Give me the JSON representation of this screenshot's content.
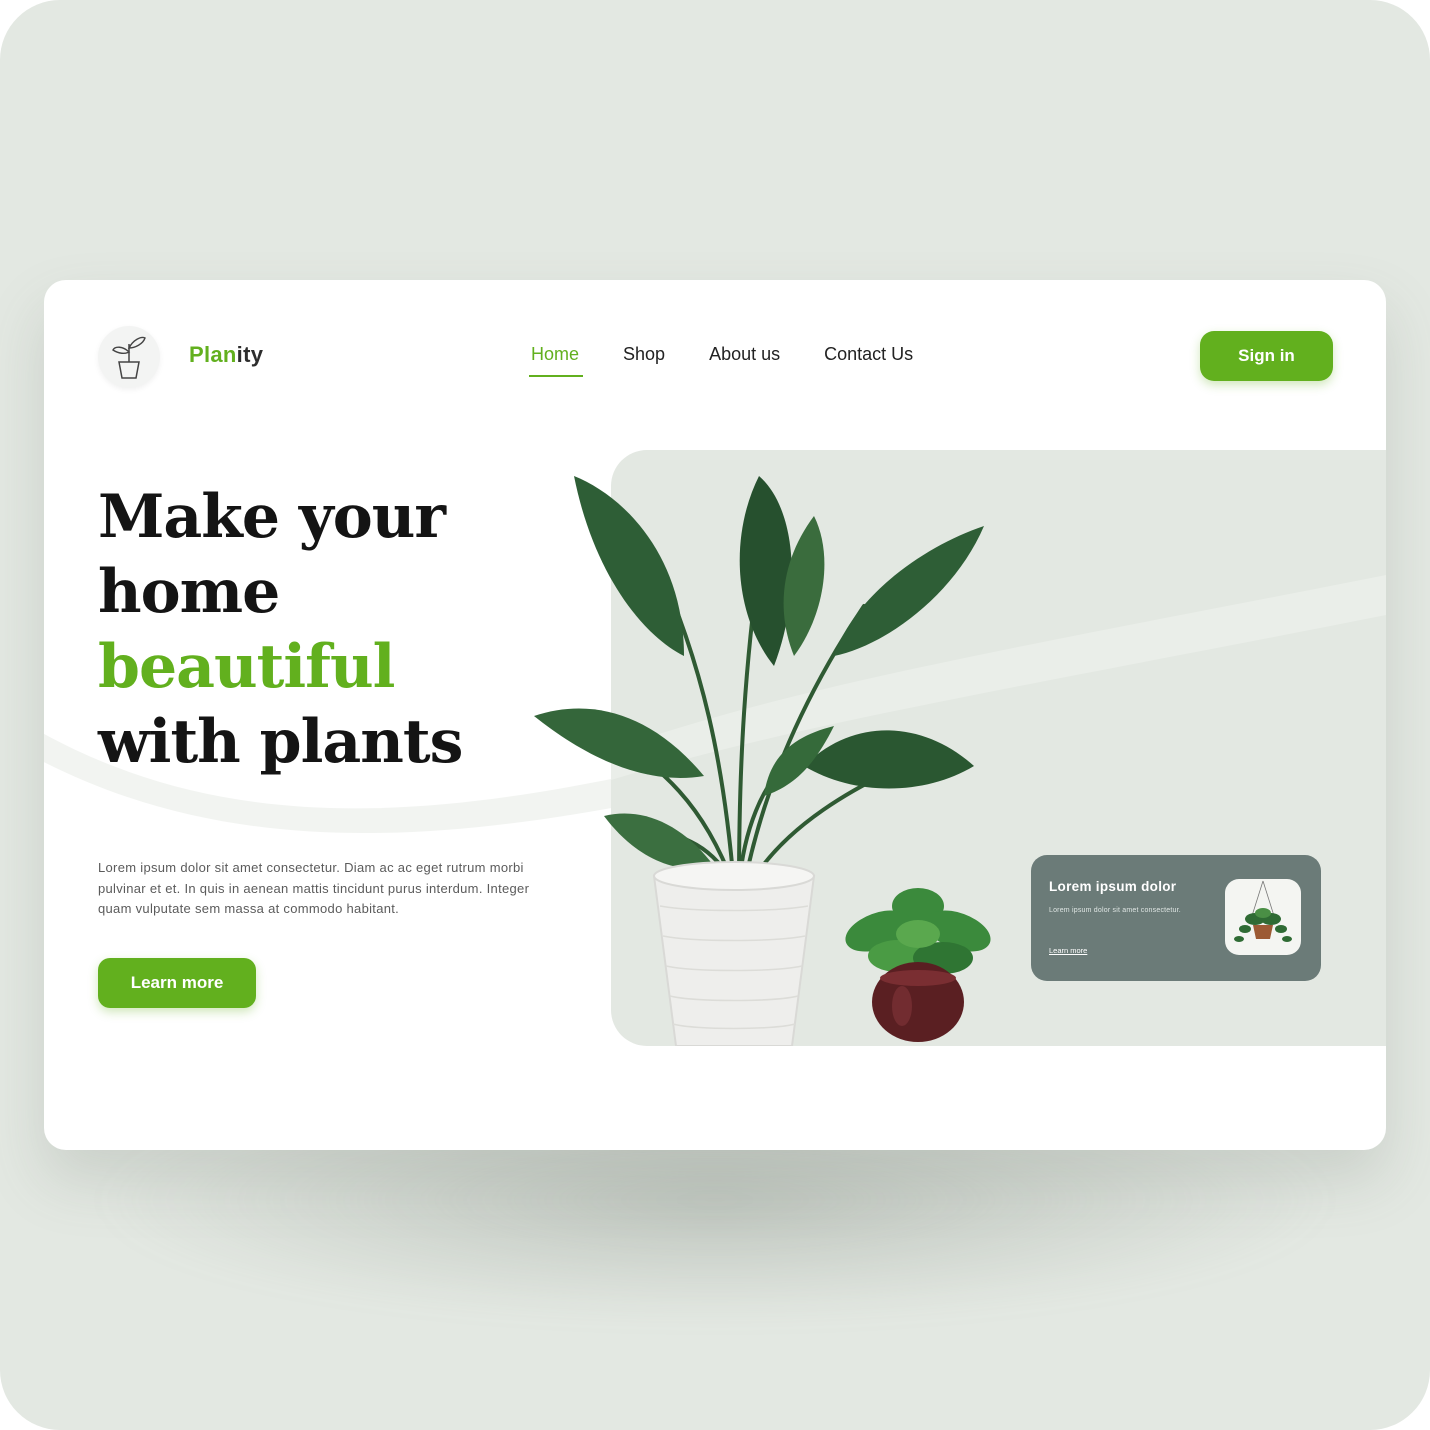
{
  "brand": {
    "name_accent": "Plan",
    "name_rest": "ity",
    "logo_icon": "plant-pot-icon"
  },
  "nav": {
    "items": [
      {
        "label": "Home",
        "active": true
      },
      {
        "label": "Shop",
        "active": false
      },
      {
        "label": "About us",
        "active": false
      },
      {
        "label": "Contact Us",
        "active": false
      }
    ]
  },
  "header": {
    "signin_label": "Sign in"
  },
  "hero": {
    "headline_line1": "Make your",
    "headline_line2": "home",
    "headline_line3": "beautiful",
    "headline_line4": "with plants",
    "description": "Lorem ipsum dolor sit amet consectetur. Diam ac ac eget rutrum morbi pulvinar et et. In quis in aenean mattis tincidunt purus interdum. Integer quam vulputate sem massa at commodo habitant.",
    "cta_label": "Learn more"
  },
  "mini_card": {
    "title": "Lorem ipsum dolor",
    "subtitle": "Lorem ipsum dolor sit amet consectetur.",
    "link_label": "Learn more"
  },
  "colors": {
    "accent": "#62b01e",
    "panel": "#e3e8e2",
    "card_dark": "#6b7b78",
    "text_dark": "#141414"
  }
}
